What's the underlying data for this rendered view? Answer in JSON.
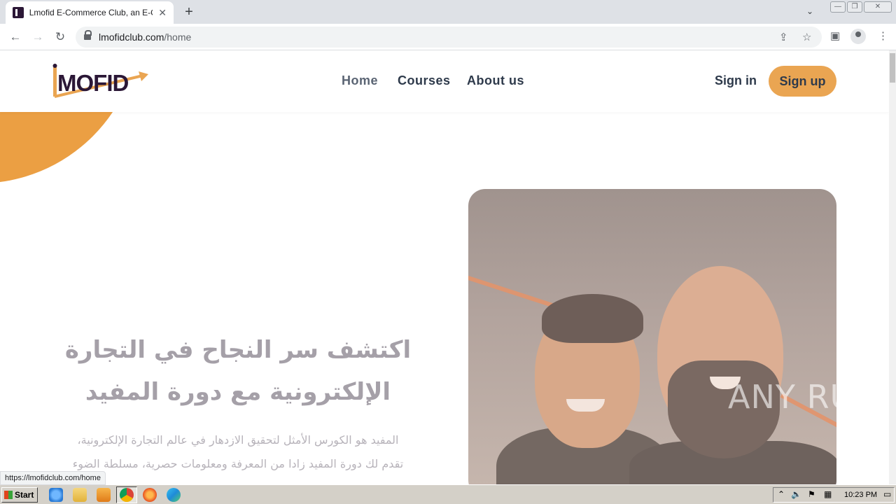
{
  "browser": {
    "tab_title": "Lmofid E-Commerce Club, an E-Comm",
    "tab_close": "✕",
    "new_tab": "+",
    "url_host": "lmofidclub.com",
    "url_path": "/home",
    "status_url": "https://lmofidclub.com/home"
  },
  "site": {
    "logo_text": "MOFID",
    "nav": {
      "home": "Home",
      "courses": "Courses",
      "about": "About us"
    },
    "sign_in": "Sign in",
    "sign_up": "Sign up",
    "hero_title_line1": "اكتشف سر النجاح في التجارة",
    "hero_title_line2": "الإلكترونية مع دورة المفيد",
    "hero_desc_line1": "المفيد هو الكورس الأمثل لتحقيق الازدهار في عالم التجارة الإلكترونية،",
    "hero_desc_line2": "تقدم لك دورة المفيد زادا من المعرفة ومعلومات حصرية، مسلطة الضوء"
  },
  "watermark": "ANY RUN",
  "taskbar": {
    "start_label": "Start",
    "clock": "10:23 PM"
  },
  "colors": {
    "accent_orange": "#eb9f43",
    "signup_bg": "#eaa552",
    "brand_dark": "#2b1736",
    "nav_text": "#2e3a4b"
  }
}
